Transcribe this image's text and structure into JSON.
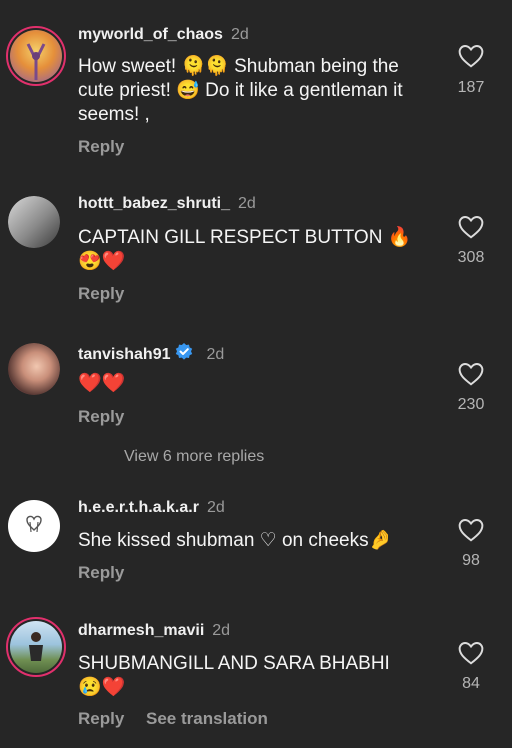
{
  "comments": [
    {
      "username": "myworld_of_chaos",
      "time": "2d",
      "text_line1": "How sweet! 🫠🫠 Shubman being the",
      "text_line2": "cute priest! 😅 Do it like a gentleman it",
      "text_line3": "seems! ,",
      "reply": "Reply",
      "likes": "187"
    },
    {
      "username": "hottt_babez_shruti_",
      "time": "2d",
      "text_line1": "CAPTAIN GILL RESPECT BUTTON 🔥",
      "text_line2": "😍❤️",
      "reply": "Reply",
      "likes": "308"
    },
    {
      "username": "tanvishah91",
      "time": "2d",
      "text_line1": "❤️❤️",
      "reply": "Reply",
      "likes": "230",
      "verified": true
    },
    {
      "username": "h.e.e.r.t.h.a.k.a.r",
      "time": "2d",
      "text_line1": "She kissed shubman ♡ on cheeks🤌",
      "reply": "Reply",
      "likes": "98"
    },
    {
      "username": "dharmesh_mavii",
      "time": "2d",
      "text_line1": "SHUBMANGILL AND SARA BHABHI",
      "text_line2": "😢❤️",
      "reply": "Reply",
      "translate": "See translation",
      "likes": "84"
    }
  ],
  "view_more_replies": "View 6 more replies",
  "icons": {
    "like": "heart-outline-icon",
    "verified": "verified-badge-icon"
  },
  "colors": {
    "background": "#262626",
    "secondary_text": "#9a9a9a",
    "verified": "#3897f0",
    "story_ring": "#e1306c"
  }
}
